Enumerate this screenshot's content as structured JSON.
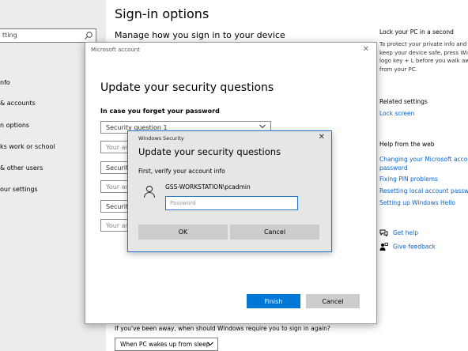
{
  "settings": {
    "search_placeholder": "tting",
    "nav_items": [
      "nfo",
      "& accounts",
      "n options",
      "ks work or school",
      "& other users",
      "our settings"
    ],
    "page_title": "Sign-in options",
    "page_subtitle": "Manage how you sign in to your device",
    "away_question": "If you've been away, when should Windows require you to sign in again?",
    "away_value": "When PC wakes up from sleep"
  },
  "right_column": {
    "lock_heading": "Lock your PC in a second",
    "lock_text": [
      "To protect your private info and",
      "keep your device safe, press Win",
      "logo key + L before you walk aw",
      "from your PC."
    ],
    "related_heading": "Related settings",
    "lock_screen_link": "Lock screen",
    "web_heading": "Help from the web",
    "web_links": [
      "Changing your Microsoft accour",
      "password",
      "Fixing PIN problems",
      "Resetting local account passwor",
      "Setting up Windows Hello"
    ],
    "get_help": "Get help",
    "give_feedback": "Give feedback",
    "link_color": "#0a63c9"
  },
  "ms_dialog": {
    "title": "Microsoft account",
    "close": "✕",
    "heading": "Update your security questions",
    "label": "In case you forget your password",
    "fields": [
      "Security question 1",
      "Your an",
      "Security",
      "Your an",
      "Security",
      "Your an"
    ],
    "finish": "Finish",
    "cancel": "Cancel",
    "accent": "#0078d7"
  },
  "ws_dialog": {
    "title": "Windows Security",
    "close": "✕",
    "heading": "Update your security questions",
    "subtitle": "First, verify your account info",
    "username": "GSS-WORKSTATION\\pcadmin",
    "password_placeholder": "Password",
    "ok": "OK",
    "cancel": "Cancel"
  }
}
